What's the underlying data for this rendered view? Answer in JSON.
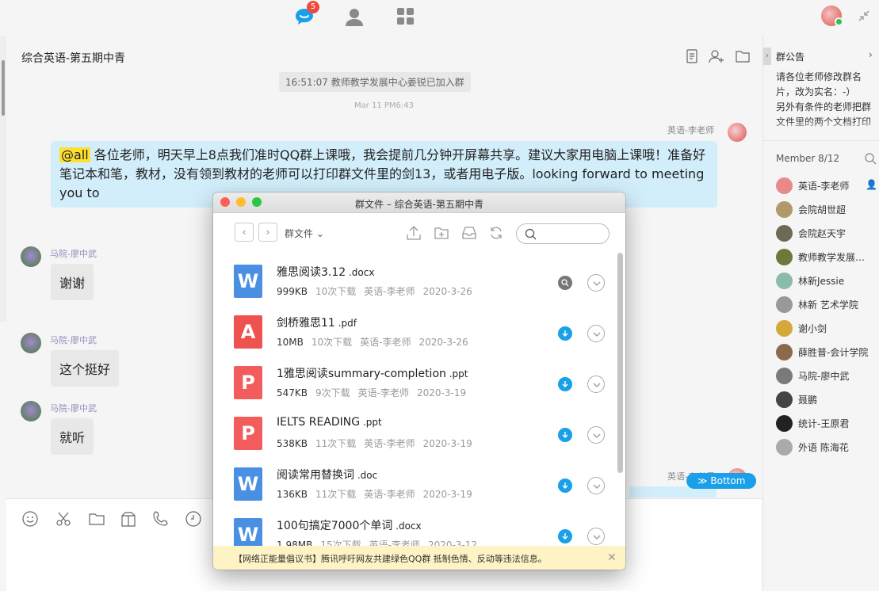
{
  "topbar": {
    "unread_badge": "5"
  },
  "chat": {
    "title": "综合英语-第五期中青",
    "system_message": "16:51:07 教师教学发展中心姜锐已加入群",
    "timestamp": "Mar 11  PM6:43",
    "messages": [
      {
        "sender": "英语-李老师",
        "mention": "@all",
        "text": " 各位老师，明天早上8点我们准时QQ群上课哦，我会提前几分钟开屏幕共享。建议大家用电脑上课哦！准备好笔记本和笔，教材，没有领到教材的老师可以打印群文件里的剑13，或者用电子版。looking forward to meeting you to"
      },
      {
        "sender": "马院-廖中武",
        "text": "谢谢"
      },
      {
        "sender": "马院-廖中武",
        "text": "这个挺好"
      },
      {
        "sender": "马院-廖中武",
        "text": "就听"
      },
      {
        "sender": "英语-李老师"
      }
    ],
    "bottom_button": "Bottom",
    "bottom_icon": "≫"
  },
  "side": {
    "announcement_title": "群公告",
    "announcement_text": "请各位老师修改群名片，改为实名：-）\n另外有条件的老师把群文件里的两个文档打印出来，可以只打印阅读",
    "member_title": "Member 8/12",
    "members": [
      {
        "name": "英语-李老师",
        "color": "#e88a8a",
        "owner": true
      },
      {
        "name": "会院胡世超",
        "color": "#b09a6a"
      },
      {
        "name": "会院赵天宇",
        "color": "#6b6b55"
      },
      {
        "name": "教师教学发展中心姜锐",
        "color": "#6a7a3a"
      },
      {
        "name": "林新Jessie",
        "color": "#8abcaa"
      },
      {
        "name": "林新 艺术学院",
        "color": "#999999"
      },
      {
        "name": "谢小剑",
        "color": "#d4a93a"
      },
      {
        "name": "薛胜普-会计学院",
        "color": "#8a6a4a"
      },
      {
        "name": "马院-廖中武",
        "color": "#7a7a7a"
      },
      {
        "name": "聂鹏",
        "color": "#444444"
      },
      {
        "name": "统计-王原君",
        "color": "#222222"
      },
      {
        "name": "外语 陈海花",
        "color": "#aaaaaa"
      }
    ]
  },
  "dialog": {
    "title": "群文件 – 综合英语-第五期中青",
    "breadcrumb": "群文件",
    "files": [
      {
        "name": "雅思阅读3.12",
        "ext": " .docx",
        "size": "999KB",
        "downloads": "10次下载",
        "uploader": "英语-李老师",
        "date": "2020-3-26",
        "type": "word",
        "letter": "W",
        "color": "#4a90e2",
        "action": "grey"
      },
      {
        "name": "剑桥雅思11",
        "ext": " .pdf",
        "size": "10MB",
        "downloads": "10次下载",
        "uploader": "英语-李老师",
        "date": "2020-3-26",
        "type": "pdf",
        "letter": "A",
        "color": "#ef5350",
        "action": "blue"
      },
      {
        "name": "1雅思阅读summary-completion",
        "ext": " .ppt",
        "size": "547KB",
        "downloads": "9次下载",
        "uploader": "英语-李老师",
        "date": "2020-3-19",
        "type": "ppt",
        "letter": "P",
        "color": "#f25c5c",
        "action": "blue"
      },
      {
        "name": "IELTS    READING",
        "ext": " .ppt",
        "size": "538KB",
        "downloads": "11次下载",
        "uploader": "英语-李老师",
        "date": "2020-3-19",
        "type": "ppt",
        "letter": "P",
        "color": "#f25c5c",
        "action": "blue"
      },
      {
        "name": "阅读常用替换词",
        "ext": " .doc",
        "size": "136KB",
        "downloads": "11次下载",
        "uploader": "英语-李老师",
        "date": "2020-3-19",
        "type": "word",
        "letter": "W",
        "color": "#4a90e2",
        "action": "blue"
      },
      {
        "name": "100句搞定7000个单词",
        "ext": " .docx",
        "size": "1.98MB",
        "downloads": "15次下载",
        "uploader": "英语-李老师",
        "date": "2020-3-12",
        "type": "word",
        "letter": "W",
        "color": "#4a90e2",
        "action": "blue"
      }
    ],
    "footer_notice": "【网络正能量倡议书】腾讯呼吁网友共建绿色QQ群 抵制色情、反动等违法信息。"
  }
}
